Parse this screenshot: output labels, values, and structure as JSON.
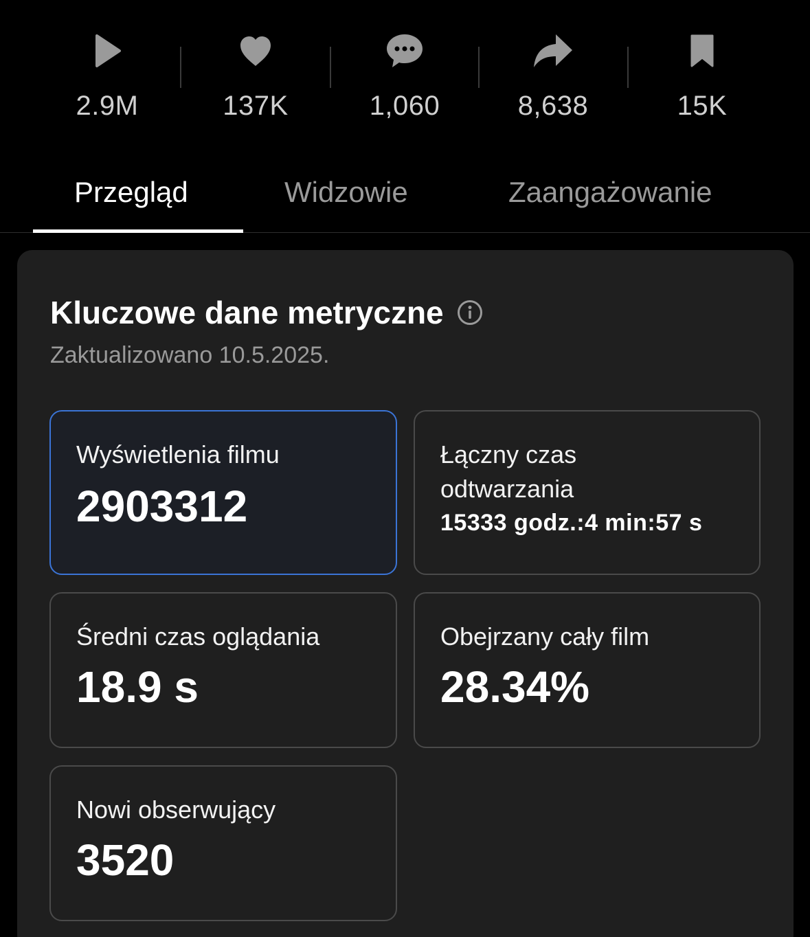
{
  "stats": [
    {
      "icon": "play-icon",
      "value": "2.9M"
    },
    {
      "icon": "heart-icon",
      "value": "137K"
    },
    {
      "icon": "comment-icon",
      "value": "1,060"
    },
    {
      "icon": "share-icon",
      "value": "8,638"
    },
    {
      "icon": "bookmark-icon",
      "value": "15K"
    }
  ],
  "tabs": [
    {
      "label": "Przegląd",
      "active": true
    },
    {
      "label": "Widzowie",
      "active": false
    },
    {
      "label": "Zaangażowanie",
      "active": false
    }
  ],
  "metrics": {
    "title": "Kluczowe dane metryczne",
    "updated": "Zaktualizowano 10.5.2025.",
    "cards": [
      {
        "label": "Wyświetlenia filmu",
        "value": "2903312",
        "selected": true
      },
      {
        "label": "Łączny czas odtwarzania",
        "value": "15333 godz.:4 min:57 s",
        "selected": false
      },
      {
        "label": "Średni czas oglądania",
        "value": "18.9 s",
        "selected": false
      },
      {
        "label": "Obejrzany cały film",
        "value": "28.34%",
        "selected": false
      },
      {
        "label": "Nowi obserwujący",
        "value": "3520",
        "selected": false
      }
    ]
  },
  "colors": {
    "background": "#000000",
    "panel": "#1f1f1f",
    "selected_border": "#3b74d6",
    "muted_text": "#9a9a9a"
  }
}
